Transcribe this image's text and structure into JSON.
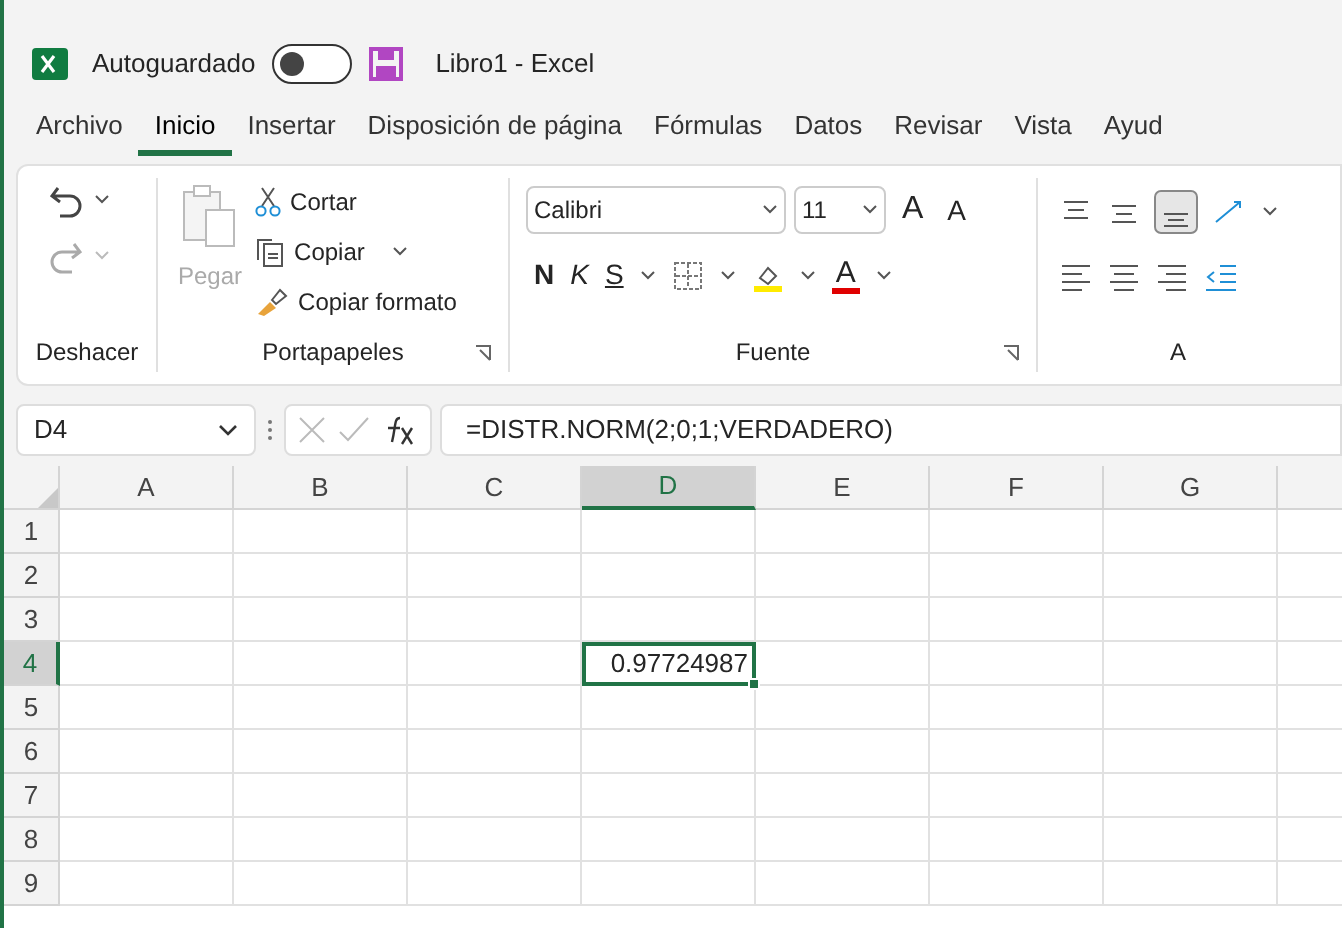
{
  "title_bar": {
    "autosave_label": "Autoguardado",
    "autosave_on": false,
    "title": "Libro1 - Excel"
  },
  "tabs": [
    {
      "label": "Archivo",
      "selected": false
    },
    {
      "label": "Inicio",
      "selected": true
    },
    {
      "label": "Insertar",
      "selected": false
    },
    {
      "label": "Disposición de página",
      "selected": false
    },
    {
      "label": "Fórmulas",
      "selected": false
    },
    {
      "label": "Datos",
      "selected": false
    },
    {
      "label": "Revisar",
      "selected": false
    },
    {
      "label": "Vista",
      "selected": false
    },
    {
      "label": "Ayud",
      "selected": false
    }
  ],
  "ribbon": {
    "undo_group": {
      "label": "Deshacer"
    },
    "clipboard_group": {
      "label": "Portapapeles",
      "paste": {
        "label": "Pegar",
        "disabled": true
      },
      "cut": "Cortar",
      "copy": "Copiar",
      "format_painter": "Copiar formato"
    },
    "font_group": {
      "label": "Fuente",
      "font": "Calibri",
      "size": "11",
      "bold": "N",
      "italic": "K",
      "underline": "S",
      "grow": "A",
      "shrink": "A",
      "font_color": "A"
    },
    "alignment_group": {
      "label": "A"
    }
  },
  "formula_bar": {
    "name_box": "D4",
    "formula": "=DISTR.NORM(2;0;1;VERDADERO)"
  },
  "sheet": {
    "columns": [
      {
        "label": "A",
        "selected": false
      },
      {
        "label": "B",
        "selected": false
      },
      {
        "label": "C",
        "selected": false
      },
      {
        "label": "D",
        "selected": true
      },
      {
        "label": "E",
        "selected": false
      },
      {
        "label": "F",
        "selected": false
      },
      {
        "label": "G",
        "selected": false
      }
    ],
    "rows": [
      {
        "label": "1",
        "selected": false
      },
      {
        "label": "2",
        "selected": false
      },
      {
        "label": "3",
        "selected": false
      },
      {
        "label": "4",
        "selected": true
      },
      {
        "label": "5",
        "selected": false
      },
      {
        "label": "6",
        "selected": false
      },
      {
        "label": "7",
        "selected": false
      },
      {
        "label": "8",
        "selected": false
      },
      {
        "label": "9",
        "selected": false
      }
    ],
    "active_cell": {
      "value": "0.97724987"
    }
  }
}
